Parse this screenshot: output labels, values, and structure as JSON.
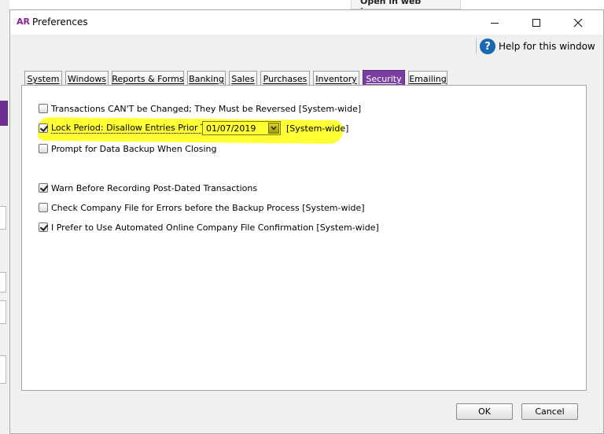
{
  "background_app": {
    "open_browser_label": "Open in web browser"
  },
  "window": {
    "logo": "AR",
    "title": "Preferences",
    "help_label": "Help for this window",
    "help_glyph": "?"
  },
  "tabs": [
    {
      "label": "System",
      "active": false
    },
    {
      "label": "Windows",
      "active": false
    },
    {
      "label": "Reports & Forms",
      "active": false
    },
    {
      "label": "Banking",
      "active": false
    },
    {
      "label": "Sales",
      "active": false
    },
    {
      "label": "Purchases",
      "active": false
    },
    {
      "label": "Inventory",
      "active": false
    },
    {
      "label": "Security",
      "active": true
    },
    {
      "label": "Emailing",
      "active": false
    }
  ],
  "security": {
    "options": [
      {
        "label": "Transactions CAN'T be Changed; They Must be Reversed [System-wide]",
        "checked": false
      },
      {
        "label": "Lock Period: Disallow Entries Prior To:",
        "checked": true
      },
      {
        "label": "Prompt for Data Backup When Closing",
        "checked": false
      },
      {
        "label": "Warn Before Recording Post-Dated Transactions",
        "checked": true
      },
      {
        "label": "Check Company File for Errors before the Backup Process [System-wide]",
        "checked": false
      },
      {
        "label": "I Prefer to Use Automated Online Company File Confirmation [System-wide]",
        "checked": true
      }
    ],
    "lock_date": "01/07/2019",
    "lock_scope": "[System-wide]",
    "highlight_color": "#ffff33"
  },
  "buttons": {
    "ok": "OK",
    "cancel": "Cancel"
  },
  "colors": {
    "accent": "#7b3fa0",
    "logo": "#8a1f96",
    "help_icon": "#1a68b0"
  }
}
